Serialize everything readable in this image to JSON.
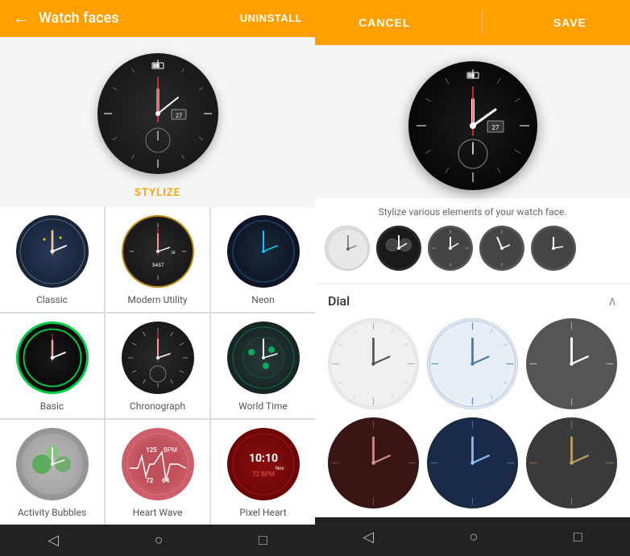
{
  "left": {
    "topBar": {
      "backIcon": "←",
      "title": "Watch faces",
      "uninstallLabel": "UNINSTALL"
    },
    "stylizeLabel": "STYLIZE",
    "watchItems": [
      {
        "id": "classic",
        "label": "Classic",
        "faceClass": "face-classic"
      },
      {
        "id": "modern",
        "label": "Modern Utility",
        "faceClass": "face-modern"
      },
      {
        "id": "neon",
        "label": "Neon",
        "faceClass": "face-neon"
      },
      {
        "id": "basic",
        "label": "Basic",
        "faceClass": "face-basic"
      },
      {
        "id": "chronograph",
        "label": "Chronograph",
        "faceClass": "face-chrono"
      },
      {
        "id": "worldtime",
        "label": "World Time",
        "faceClass": "face-world"
      },
      {
        "id": "activity",
        "label": "Activity Bubbles",
        "faceClass": "face-activity"
      },
      {
        "id": "heart",
        "label": "Heart Wave",
        "faceClass": "face-heart"
      },
      {
        "id": "pixel",
        "label": "Pixel Heart",
        "faceClass": "face-pixel"
      }
    ],
    "bottomNav": {
      "back": "◁",
      "home": "○",
      "recent": "□"
    }
  },
  "right": {
    "topBar": {
      "cancelLabel": "CANCEL",
      "saveLabel": "SAVE"
    },
    "stylizeHint": "Stylize various elements of your watch face.",
    "dial": {
      "title": "Dial",
      "collapseIcon": "∧",
      "options": [
        {
          "id": "white",
          "class": "dial-white"
        },
        {
          "id": "light-blue",
          "class": "dial-light-blue"
        },
        {
          "id": "dark",
          "class": "dial-dark"
        },
        {
          "id": "dark-red",
          "class": "dial-dark-red"
        },
        {
          "id": "navy",
          "class": "dial-navy"
        },
        {
          "id": "dark-gray",
          "class": "dial-dark-gray"
        }
      ]
    },
    "bottomNav": {
      "back": "◁",
      "home": "○",
      "recent": "□"
    }
  }
}
